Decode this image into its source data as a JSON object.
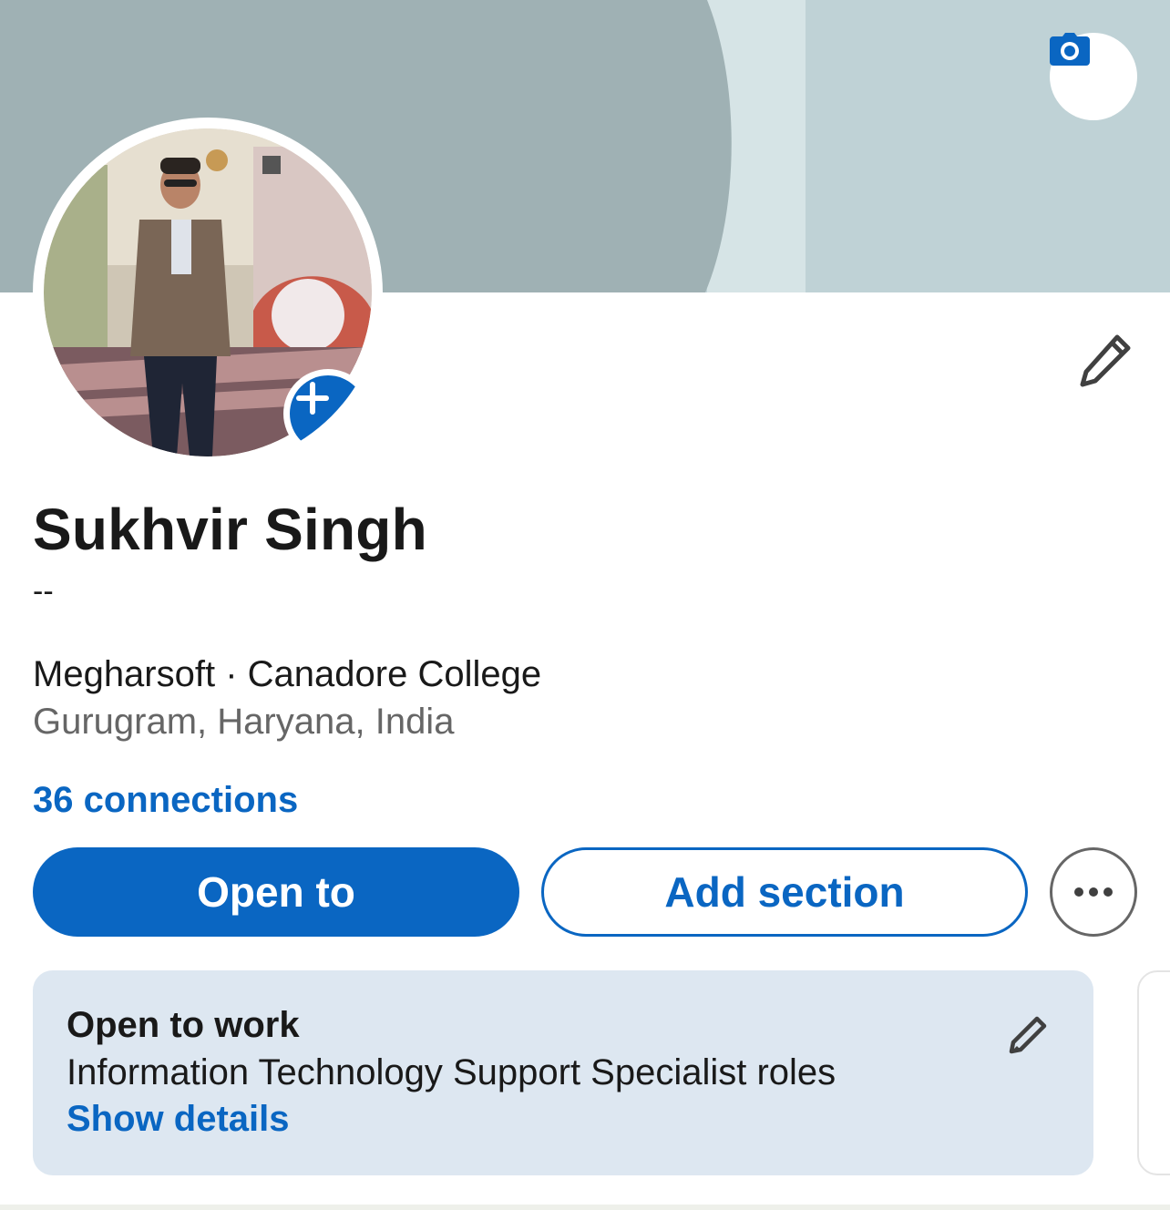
{
  "profile": {
    "name": "Sukhvir Singh",
    "headline": "--",
    "work_line": "Megharsoft · Canadore College",
    "location": "Gurugram, Haryana, India",
    "connections": "36 connections"
  },
  "actions": {
    "open_to": "Open to",
    "add_section": "Add section",
    "more_icon": "more-horizontal-icon"
  },
  "open_to_work": {
    "title": "Open to work",
    "description": "Information Technology Support Specialist roles",
    "link": "Show details"
  },
  "icons": {
    "cover_camera": "camera-icon",
    "add_photo": "plus-icon",
    "edit_intro": "pencil-icon",
    "edit_open_to_work": "pencil-icon"
  },
  "colors": {
    "brand_blue": "#0a66c2",
    "card_bg": "#dde7f1",
    "cover_dark": "#9fb1b4",
    "cover_light": "#bfd2d6"
  }
}
